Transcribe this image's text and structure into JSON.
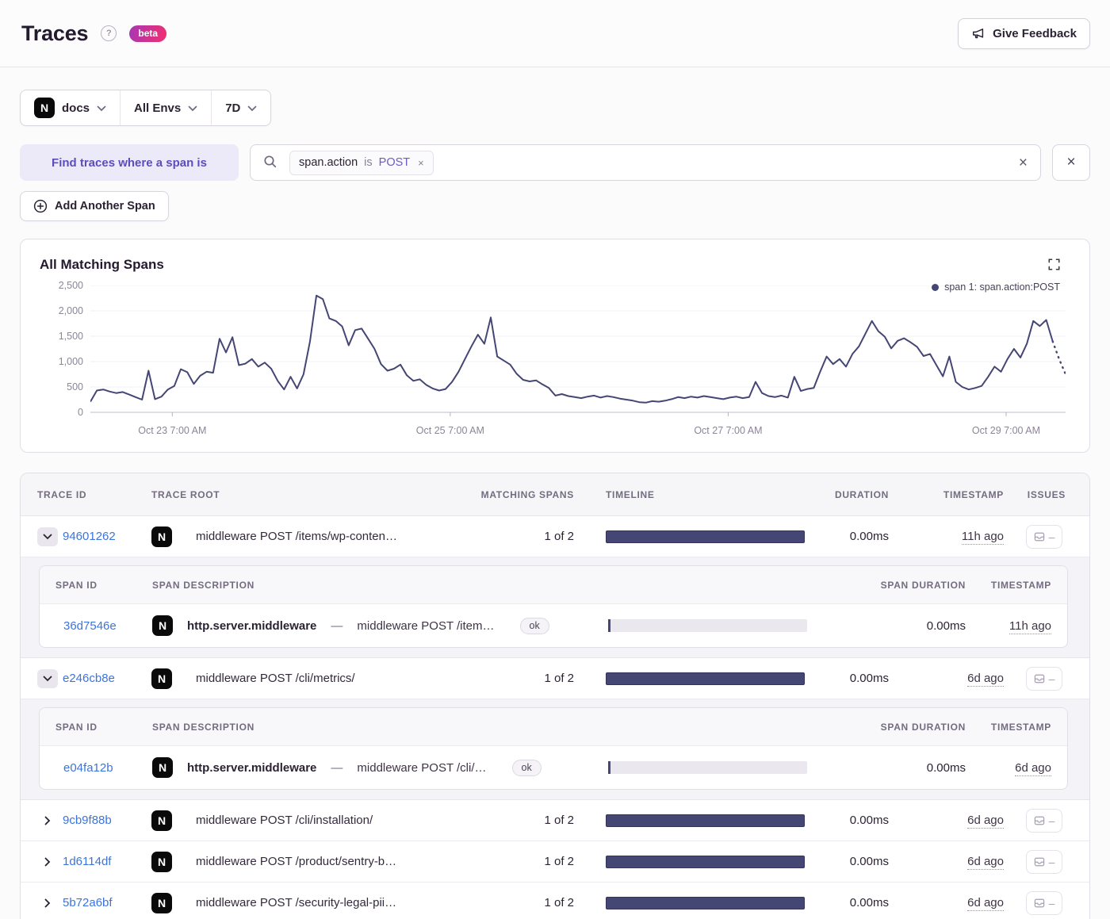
{
  "header": {
    "title": "Traces",
    "help": "?",
    "beta": "beta",
    "feedback": "Give Feedback"
  },
  "filters": {
    "project": "docs",
    "project_platform": "N",
    "environment": "All Envs",
    "period": "7D"
  },
  "query": {
    "find_label": "Find traces where a span is",
    "token_key": "span.action",
    "token_op": "is",
    "token_value": "POST",
    "token_remove": "×",
    "clear": "×",
    "close": "×",
    "add_span": "Add Another Span"
  },
  "chart": {
    "title": "All Matching Spans",
    "legend": "span 1: span.action:POST"
  },
  "chart_data": {
    "type": "line",
    "title": "All Matching Spans",
    "legend_position": "top-right",
    "grid": true,
    "line_color": "#444674",
    "ylim": [
      0,
      2500
    ],
    "y_ticks": [
      0,
      500,
      1000,
      1500,
      2000,
      2500
    ],
    "y_tick_labels": [
      "0",
      "500",
      "1,000",
      "1,500",
      "2,000",
      "2,500"
    ],
    "x_tick_labels": [
      "Oct 23 7:00 AM",
      "Oct 25 7:00 AM",
      "Oct 27 7:00 AM",
      "Oct 29 7:00 AM"
    ],
    "x_tick_fractions": [
      0.084,
      0.369,
      0.654,
      0.939
    ],
    "dashed_from_index": 149,
    "series": [
      {
        "name": "span 1: span.action:POST",
        "values": [
          210,
          430,
          450,
          410,
          380,
          400,
          350,
          300,
          250,
          820,
          260,
          310,
          450,
          520,
          850,
          790,
          560,
          720,
          800,
          780,
          1450,
          1180,
          1480,
          930,
          960,
          1050,
          900,
          980,
          860,
          620,
          450,
          700,
          470,
          750,
          1400,
          2300,
          2230,
          1850,
          1800,
          1690,
          1320,
          1620,
          1650,
          1450,
          1250,
          950,
          820,
          860,
          940,
          730,
          620,
          650,
          540,
          470,
          430,
          460,
          600,
          800,
          1050,
          1300,
          1530,
          1350,
          1870,
          1100,
          1020,
          940,
          760,
          640,
          610,
          630,
          550,
          480,
          330,
          360,
          320,
          300,
          280,
          310,
          330,
          290,
          320,
          300,
          270,
          250,
          230,
          200,
          190,
          220,
          210,
          230,
          260,
          300,
          280,
          310,
          290,
          320,
          300,
          280,
          260,
          290,
          310,
          280,
          300,
          600,
          380,
          320,
          300,
          330,
          290,
          700,
          420,
          460,
          480,
          800,
          1100,
          950,
          1050,
          900,
          1150,
          1300,
          1550,
          1800,
          1600,
          1490,
          1260,
          1410,
          1460,
          1380,
          1290,
          1110,
          1150,
          930,
          710,
          1100,
          600,
          500,
          450,
          480,
          520,
          700,
          900,
          800,
          1050,
          1250,
          1080,
          1350,
          1800,
          1700,
          1820,
          1400,
          1050,
          750
        ]
      }
    ]
  },
  "table": {
    "columns": {
      "trace_id": "TRACE ID",
      "trace_root": "TRACE ROOT",
      "matching_spans": "MATCHING SPANS",
      "timeline": "TIMELINE",
      "duration": "DURATION",
      "timestamp": "TIMESTAMP",
      "issues": "ISSUES"
    },
    "span_columns": {
      "span_id": "SPAN ID",
      "span_description": "SPAN DESCRIPTION",
      "span_duration": "SPAN DURATION",
      "timestamp": "TIMESTAMP"
    },
    "rows": [
      {
        "trace_id": "94601262",
        "root": "middleware POST /items/wp-conten…",
        "matching": "1 of 2",
        "duration": "0.00ms",
        "timestamp": "11h ago",
        "spans": [
          {
            "span_id": "36d7546e",
            "op": "http.server.middleware",
            "separator": "—",
            "description": "middleware POST /item…",
            "status": "ok",
            "duration": "0.00ms",
            "timestamp": "11h ago"
          }
        ]
      },
      {
        "trace_id": "e246cb8e",
        "root": "middleware POST /cli/metrics/",
        "matching": "1 of 2",
        "duration": "0.00ms",
        "timestamp": "6d ago",
        "spans": [
          {
            "span_id": "e04fa12b",
            "op": "http.server.middleware",
            "separator": "—",
            "description": "middleware POST /cli/…",
            "status": "ok",
            "duration": "0.00ms",
            "timestamp": "6d ago"
          }
        ]
      },
      {
        "trace_id": "9cb9f88b",
        "root": "middleware POST /cli/installation/",
        "matching": "1 of 2",
        "duration": "0.00ms",
        "timestamp": "6d ago"
      },
      {
        "trace_id": "1d6114df",
        "root": "middleware POST /product/sentry-b…",
        "matching": "1 of 2",
        "duration": "0.00ms",
        "timestamp": "6d ago"
      },
      {
        "trace_id": "5b72a6bf",
        "root": "middleware POST /security-legal-pii…",
        "matching": "1 of 2",
        "duration": "0.00ms",
        "timestamp": "6d ago"
      }
    ]
  }
}
